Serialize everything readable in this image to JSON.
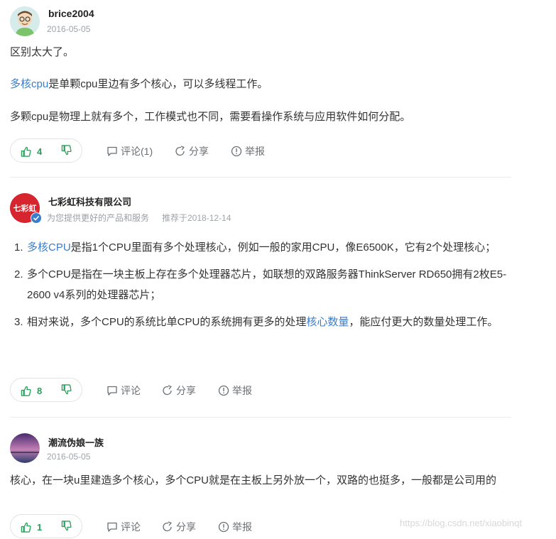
{
  "answers": [
    {
      "username": "brice2004",
      "date": "2016-05-05",
      "paragraphs": {
        "p1": "区别太大了。",
        "p2_link": "多核cpu",
        "p2_rest": "是单颗cpu里边有多个核心，可以多线程工作。",
        "p3": "多颗cpu是物理上就有多个，工作模式也不同，需要看操作系统与应用软件如何分配。"
      },
      "votes": "4",
      "comment_label": "评论(1)",
      "share_label": "分享",
      "report_label": "举报"
    },
    {
      "username": "七彩虹科技有限公司",
      "subtitle": "为您提供更好的产品和服务",
      "recommend": "推荐于2018-12-14",
      "avatar_text": "七彩虹",
      "items": [
        {
          "num": "1.",
          "link": "多核CPU",
          "rest": "是指1个CPU里面有多个处理核心，例如一般的家用CPU，像E6500K，它有2个处理核心；"
        },
        {
          "num": "2.",
          "text": "多个CPU是指在一块主板上存在多个处理器芯片，如联想的双路服务器ThinkServer RD650拥有2枚E5-2600 v4系列的处理器芯片；"
        },
        {
          "num": "3.",
          "before": "相对来说，多个CPU的系统比单CPU的系统拥有更多的处理",
          "link": "核心数量",
          "after": "，能应付更大的数量处理工作。"
        }
      ],
      "votes": "8",
      "comment_label": "评论",
      "share_label": "分享",
      "report_label": "举报"
    },
    {
      "username": "潮流伪娘一族",
      "date": "2016-05-05",
      "text": "核心，在一块u里建造多个核心，多个CPU就是在主板上另外放一个，双路的也挺多，一般都是公司用的",
      "votes": "1",
      "comment_label": "评论",
      "share_label": "分享",
      "report_label": "举报"
    }
  ],
  "watermark": "https://blog.csdn.net/xiaobinqt",
  "colors": {
    "link": "#3a7dc9",
    "vote_green": "#29a05b",
    "meta": "#a0a4a8"
  },
  "icons": [
    "thumbs-up-icon",
    "thumbs-down-icon",
    "comment-icon",
    "share-icon",
    "report-icon",
    "verified-icon"
  ]
}
